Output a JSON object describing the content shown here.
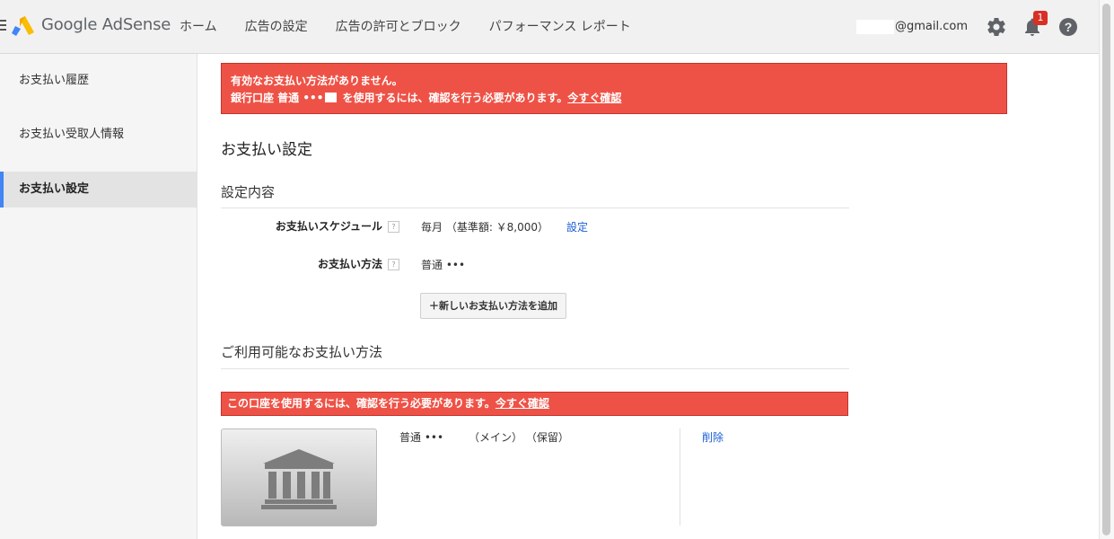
{
  "header": {
    "brand": "Google AdSense",
    "nav": [
      {
        "label": "ホーム"
      },
      {
        "label": "広告の設定"
      },
      {
        "label": "広告の許可とブロック"
      },
      {
        "label": "パフォーマンス レポート"
      }
    ],
    "email": "@gmail.com",
    "notification_count": "1",
    "icons": [
      "menu-icon",
      "adsense-logo",
      "gear-icon",
      "bell-icon",
      "help-icon"
    ]
  },
  "sidebar": {
    "items": [
      {
        "label": "お支払い履歴",
        "active": false
      },
      {
        "label": "お支払い受取人情報",
        "active": false
      },
      {
        "label": "お支払い設定",
        "active": true
      }
    ]
  },
  "alert": {
    "line1": "有効なお支払い方法がありません。",
    "line2_prefix": "銀行口座 普通 •••",
    "line2_suffix": " を使用するには、確認を行う必要があります。",
    "link": "今すぐ確認"
  },
  "page": {
    "title": "お支払い設定",
    "settings_heading": "設定内容",
    "schedule_label": "お支払いスケジュール",
    "schedule_value": "毎月 （基準額: ￥8,000）",
    "schedule_link": "設定",
    "method_label": "お支払い方法",
    "method_value": "普通 •••",
    "add_button": "新しいお支払い方法を追加",
    "available_heading": "ご利用可能なお支払い方法",
    "verify_text": "この口座を使用するには、確認を行う必要があります。",
    "verify_link": "今すぐ確認",
    "account_type": "普通 •••",
    "account_tags": "（メイン） （保留）",
    "delete_link": "削除"
  },
  "colors": {
    "alert_red": "#ee5246",
    "link_blue": "#1a5fd6",
    "active_accent": "#4285f4",
    "badge_red": "#d93025"
  }
}
